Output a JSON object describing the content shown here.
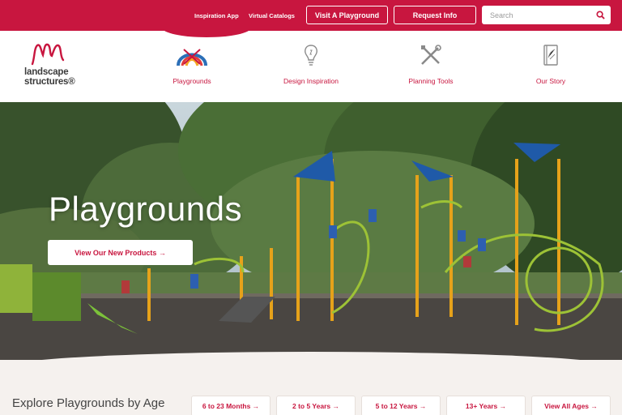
{
  "topbar": {
    "links": [
      "Inspiration App",
      "Virtual Catalogs"
    ],
    "visit_button": "Visit A Playground",
    "request_button": "Request Info",
    "search_placeholder": "Search"
  },
  "brand": {
    "logo_line1": "landscape",
    "logo_line2": "structures®",
    "color": "#c8163f"
  },
  "nav": {
    "items": [
      {
        "label": "Playgrounds",
        "icon": "playground-arch-icon"
      },
      {
        "label": "Design Inspiration",
        "icon": "lightbulb-icon"
      },
      {
        "label": "Planning Tools",
        "icon": "tools-icon"
      },
      {
        "label": "Our Story",
        "icon": "book-icon"
      }
    ]
  },
  "hero": {
    "title": "Playgrounds",
    "cta": "View Our New Products →"
  },
  "explore": {
    "title": "Explore Playgrounds by Age",
    "ages": [
      "6 to 23 Months →",
      "2 to 5 Years →",
      "5 to 12 Years →",
      "13+ Years →",
      "View All Ages →"
    ]
  }
}
